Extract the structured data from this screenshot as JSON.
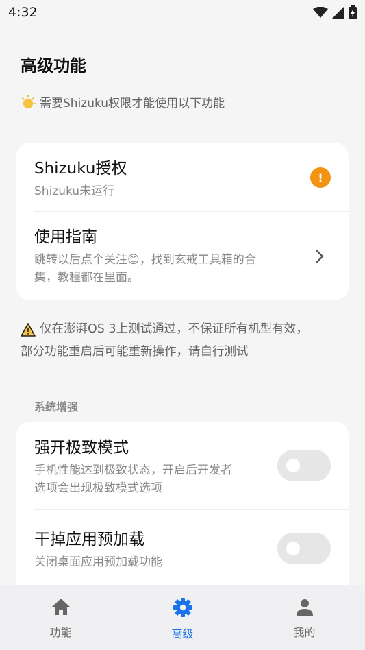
{
  "status_bar": {
    "time": "4:32"
  },
  "header": {
    "title": "高级功能"
  },
  "notice": {
    "text": "需要Shizuku权限才能使用以下功能"
  },
  "auth_card": {
    "items": [
      {
        "title": "Shizuku授权",
        "subtitle": "Shizuku未运行",
        "badge": "!"
      },
      {
        "title": "使用指南",
        "subtitle_line1": "跳转以后点个关注😊，找到玄戒工具箱的合",
        "subtitle_line2": "集，教程都在里面。"
      }
    ]
  },
  "warning": {
    "line1": "仅在澎湃OS 3上测试通过，不保证所有机型有效，",
    "line2": "部分功能重启后可能重新操作，请自行测试"
  },
  "system_section": {
    "label": "系统增强",
    "items": [
      {
        "title": "强开极致模式",
        "subtitle_line1": "手机性能达到极致状态，开启后开发者",
        "subtitle_line2": "选项会出现极致模式选项",
        "enabled": false
      },
      {
        "title": "干掉应用预加载",
        "subtitle_line1": "关闭桌面应用预加载功能",
        "enabled": false
      }
    ]
  },
  "bottom_nav": {
    "items": [
      {
        "label": "功能",
        "icon": "home-icon",
        "active": false
      },
      {
        "label": "高级",
        "icon": "gear-icon",
        "active": true
      },
      {
        "label": "我的",
        "icon": "person-icon",
        "active": false
      }
    ]
  },
  "colors": {
    "accent": "#1a73e8",
    "warning": "#f39312",
    "background": "#f5f5f5"
  }
}
